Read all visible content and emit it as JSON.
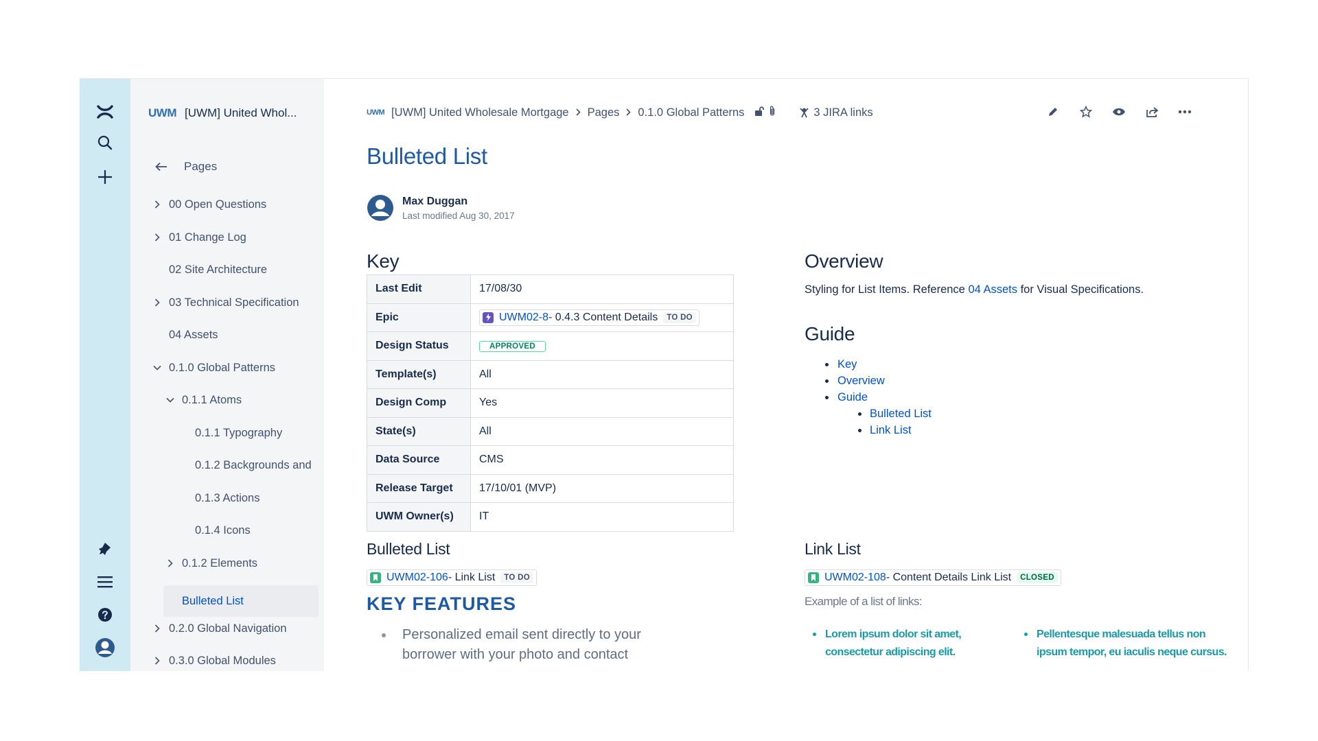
{
  "space": {
    "logo": "UWM",
    "name": "[UWM] United Whol..."
  },
  "sidebar": {
    "pages_label": "Pages",
    "items": [
      {
        "label": "00 Open Questions"
      },
      {
        "label": "01 Change Log"
      },
      {
        "label": "02 Site Architecture"
      },
      {
        "label": "03 Technical Specification"
      },
      {
        "label": "04 Assets"
      },
      {
        "label": "0.1.0 Global Patterns"
      },
      {
        "label": "0.1.1 Atoms"
      },
      {
        "label": "0.1.1 Typography"
      },
      {
        "label": "0.1.2 Backgrounds and"
      },
      {
        "label": "0.1.3 Actions"
      },
      {
        "label": "0.1.4 Icons"
      },
      {
        "label": "0.1.2 Elements"
      },
      {
        "label": "Bulleted List"
      },
      {
        "label": "0.2.0 Global Navigation"
      },
      {
        "label": "0.3.0 Global Modules"
      }
    ]
  },
  "breadcrumbs": {
    "logo": "UWM",
    "items": [
      "[UWM] United Wholesale Mortgage",
      "Pages",
      "0.1.0 Global Patterns"
    ],
    "jira_links": "3 JIRA links"
  },
  "page": {
    "title": "Bulleted List",
    "author": "Max Duggan",
    "modified": "Last modified Aug 30, 2017"
  },
  "key": {
    "heading": "Key",
    "rows": [
      {
        "label": "Last Edit",
        "value": "17/08/30"
      },
      {
        "label": "Epic",
        "value": ""
      },
      {
        "label": "Design Status",
        "value": ""
      },
      {
        "label": "Template(s)",
        "value": "All"
      },
      {
        "label": "Design Comp",
        "value": "Yes"
      },
      {
        "label": "State(s)",
        "value": "All"
      },
      {
        "label": "Data Source",
        "value": "CMS"
      },
      {
        "label": "Release Target",
        "value": "17/10/01 (MVP)"
      },
      {
        "label": "UWM Owner(s)",
        "value": "IT"
      }
    ],
    "epic": {
      "key": "UWM02-8",
      "summary": " - 0.4.3 Content Details",
      "status": "TO DO"
    },
    "design_status": "APPROVED"
  },
  "overview": {
    "heading": "Overview",
    "text_before": "Styling for List Items. Reference ",
    "link": "04 Assets",
    "text_after": " for Visual Specifications."
  },
  "guide": {
    "heading": "Guide",
    "items": [
      "Key",
      "Overview",
      "Guide",
      "Bulleted List",
      "Link List"
    ]
  },
  "bulleted_list": {
    "heading": "Bulleted List",
    "issue": {
      "key": "UWM02-106",
      "summary": " - Link List",
      "status": "TO DO"
    },
    "feature_title": "KEY FEATURES",
    "feature_bullet": "Personalized email sent directly to your borrower with your photo and contact"
  },
  "link_list": {
    "heading": "Link List",
    "issue": {
      "key": "UWM02-108",
      "summary": " - Content Details Link List",
      "status": "CLOSED"
    },
    "caption": "Example of a list of links:",
    "links": [
      "Lorem ipsum dolor sit amet, consectetur adipiscing elit.",
      "Pellentesque malesuada tellus non ipsum tempor, eu iaculis neque cursus."
    ]
  },
  "colors": {
    "accent": "#0052CC",
    "title": "#1d5aa3",
    "global_nav": "#cfeaf2",
    "sidebar": "#f4f5f7",
    "link_list": "#1a9aa8"
  }
}
